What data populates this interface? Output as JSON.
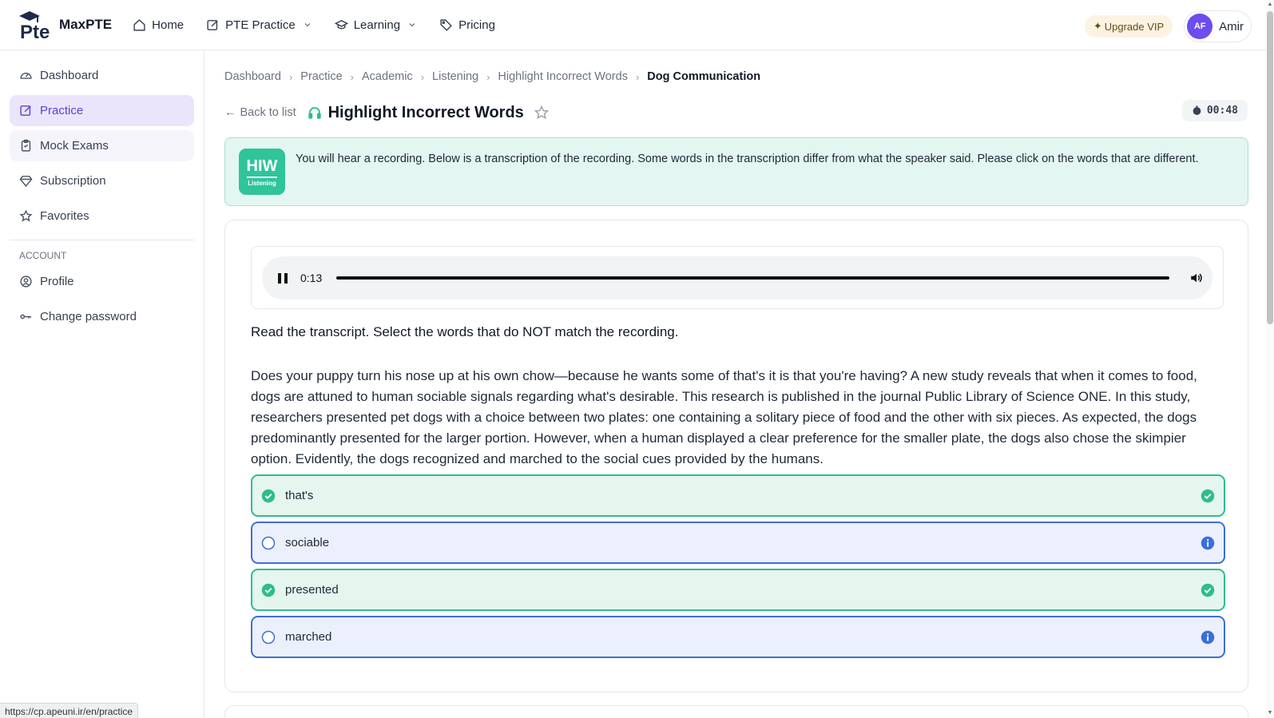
{
  "header": {
    "brand": "MaxPTE",
    "logo_text": "Pte",
    "nav": [
      {
        "label": "Home",
        "icon": "home-icon"
      },
      {
        "label": "PTE Practice",
        "icon": "edit-icon",
        "dropdown": true
      },
      {
        "label": "Learning",
        "icon": "graduation-cap-icon",
        "dropdown": true
      },
      {
        "label": "Pricing",
        "icon": "tag-icon"
      }
    ],
    "upgrade_label": "Upgrade VIP",
    "user_initials": "AF",
    "user_name": "Amir"
  },
  "sidebar": {
    "items": [
      {
        "label": "Dashboard",
        "icon": "gauge-icon"
      },
      {
        "label": "Practice",
        "icon": "edit-icon",
        "active": true
      },
      {
        "label": "Mock Exams",
        "icon": "clipboard-icon"
      },
      {
        "label": "Subscription",
        "icon": "diamond-icon"
      },
      {
        "label": "Favorites",
        "icon": "star-icon"
      }
    ],
    "account_heading": "ACCOUNT",
    "account_items": [
      {
        "label": "Profile",
        "icon": "user-circle-icon"
      },
      {
        "label": "Change password",
        "icon": "key-icon"
      }
    ]
  },
  "breadcrumb": [
    "Dashboard",
    "Practice",
    "Academic",
    "Listening",
    "Highlight Incorrect Words",
    "Dog Communication"
  ],
  "title": {
    "back_label": "Back to list",
    "page_title": "Highlight Incorrect Words",
    "timer": "00:48"
  },
  "instruction": {
    "badge_big": "HIW",
    "badge_small": "Listening",
    "text": "You will hear a recording. Below is a transcription of the recording. Some words in the transcription differ from what the speaker said. Please click on the words that are different."
  },
  "audio": {
    "current_time": "0:13",
    "progress": 1.0
  },
  "prompt": "Read the transcript. Select the words that do NOT match the recording.",
  "transcript": "Does your puppy turn his nose up at his own chow—because he wants some of that's it is that you're having? A new study reveals that when it comes to food, dogs are attuned to human sociable signals regarding what's desirable. This research is published in the journal Public Library of Science ONE. In this study, researchers presented pet dogs with a choice between two plates: one containing a solitary piece of food and the other with six pieces. As expected, the dogs predominantly presented for the larger portion. However, when a human displayed a clear preference for the smaller plate, the dogs also chose the skimpier option. Evidently, the dogs recognized and marched to the social cues provided by the humans.",
  "answers": [
    {
      "word": "that's",
      "status": "correct"
    },
    {
      "word": "sociable",
      "status": "missed"
    },
    {
      "word": "presented",
      "status": "correct"
    },
    {
      "word": "marched",
      "status": "missed"
    }
  ],
  "status_url": "https://cp.apeuni.ir/en/practice",
  "colors": {
    "accent": "#5b3fd6",
    "correct": "#2ebd8e",
    "missed": "#3b6fd9",
    "instruction_bg": "#e4f6f1"
  }
}
